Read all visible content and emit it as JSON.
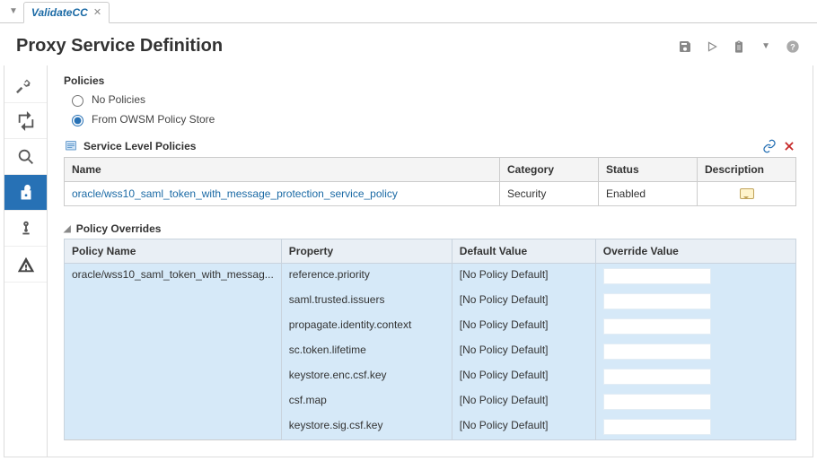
{
  "tab": {
    "label": "ValidateCC"
  },
  "page_title": "Proxy Service Definition",
  "policies": {
    "heading": "Policies",
    "no_policies_label": "No Policies",
    "owsm_label": "From OWSM Policy Store",
    "selected": "owsm"
  },
  "service_level": {
    "heading": "Service Level Policies",
    "columns": {
      "name": "Name",
      "category": "Category",
      "status": "Status",
      "description": "Description"
    },
    "rows": [
      {
        "name": "oracle/wss10_saml_token_with_message_protection_service_policy",
        "category": "Security",
        "status": "Enabled"
      }
    ]
  },
  "overrides": {
    "heading": "Policy Overrides",
    "columns": {
      "policy_name": "Policy Name",
      "property": "Property",
      "default_value": "Default Value",
      "override_value": "Override Value"
    },
    "policy_name": "oracle/wss10_saml_token_with_messag...",
    "rows": [
      {
        "property": "reference.priority",
        "default": "[No Policy Default]"
      },
      {
        "property": "saml.trusted.issuers",
        "default": "[No Policy Default]"
      },
      {
        "property": "propagate.identity.context",
        "default": "[No Policy Default]"
      },
      {
        "property": "sc.token.lifetime",
        "default": "[No Policy Default]"
      },
      {
        "property": "keystore.enc.csf.key",
        "default": "[No Policy Default]"
      },
      {
        "property": "csf.map",
        "default": "[No Policy Default]"
      },
      {
        "property": "keystore.sig.csf.key",
        "default": "[No Policy Default]"
      }
    ]
  }
}
